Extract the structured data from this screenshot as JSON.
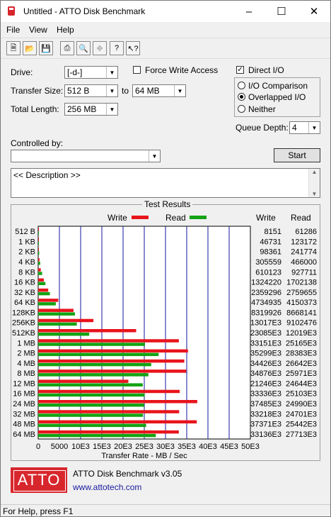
{
  "window": {
    "title": "Untitled - ATTO Disk Benchmark"
  },
  "menu": [
    "File",
    "View",
    "Help"
  ],
  "toolbar_icons": [
    "new-icon",
    "open-icon",
    "save-icon",
    "print-icon",
    "print-preview-icon",
    "move-icon",
    "help-icon",
    "context-help-icon"
  ],
  "labels": {
    "drive": "Drive:",
    "transfer_size": "Transfer Size:",
    "to": "to",
    "total_length": "Total Length:",
    "force_write": "Force Write Access",
    "direct_io": "Direct I/O",
    "io_comparison": "I/O Comparison",
    "overlapped_io": "Overlapped I/O",
    "neither": "Neither",
    "queue_depth": "Queue Depth:",
    "controlled_by": "Controlled by:",
    "start": "Start",
    "description": "<< Description >>",
    "test_results": "Test Results",
    "write": "Write",
    "read": "Read",
    "write_col": "Write",
    "read_col": "Read",
    "xlabel": "Transfer Rate - MB / Sec"
  },
  "values": {
    "drive": "[-d-]",
    "transfer_from": "512 B",
    "transfer_to": "64 MB",
    "total_length": "256 MB",
    "queue_depth": "4",
    "controlled_by": ""
  },
  "state": {
    "force_write": false,
    "direct_io": true,
    "mode": "overlapped_io"
  },
  "chart_data": {
    "type": "bar",
    "categories": [
      "512 B",
      "1 KB",
      "2 KB",
      "4 KB",
      "8 KB",
      "16 KB",
      "32 KB",
      "64 KB",
      "128KB",
      "256KB",
      "512KB",
      "1 MB",
      "2 MB",
      "4 MB",
      "8 MB",
      "12 MB",
      "16 MB",
      "24 MB",
      "32 MB",
      "48 MB",
      "64 MB"
    ],
    "series": [
      {
        "name": "Write",
        "color": "#e8141c",
        "values": [
          8151,
          46731,
          98361,
          305559,
          610123,
          1324220,
          2359296,
          4734935,
          8319926,
          13017000,
          23085000,
          33151000,
          35299000,
          34426000,
          34876000,
          21246000,
          33336000,
          37485000,
          33218000,
          37371000,
          33136000
        ]
      },
      {
        "name": "Read",
        "color": "#13a313",
        "values": [
          61286,
          123172,
          241774,
          466000,
          927711,
          1702138,
          2759655,
          4150373,
          8668141,
          9102476,
          12019000,
          25165000,
          28383000,
          26642000,
          25971000,
          24644000,
          25103000,
          24990000,
          24701000,
          25442000,
          27713000
        ]
      }
    ],
    "write_text": [
      "8151",
      "46731",
      "98361",
      "305559",
      "610123",
      "1324220",
      "2359296",
      "4734935",
      "8319926",
      "13017E3",
      "23085E3",
      "33151E3",
      "35299E3",
      "34426E3",
      "34876E3",
      "21246E3",
      "33336E3",
      "37485E3",
      "33218E3",
      "37371E3",
      "33136E3"
    ],
    "read_text": [
      "61286",
      "123172",
      "241774",
      "466000",
      "927711",
      "1702138",
      "2759655",
      "4150373",
      "8668141",
      "9102476",
      "12019E3",
      "25165E3",
      "28383E3",
      "26642E3",
      "25971E3",
      "24644E3",
      "25103E3",
      "24990E3",
      "24701E3",
      "25442E3",
      "27713E3"
    ],
    "xticks": [
      "0",
      "5000",
      "10E3",
      "15E3",
      "20E3",
      "25E3",
      "30E3",
      "35E3",
      "40E3",
      "45E3",
      "50E3"
    ],
    "xlim": [
      0,
      50000000
    ],
    "xlabel": "Transfer Rate - MB / Sec",
    "grid": true,
    "legend": "top"
  },
  "footer": {
    "app_name": "ATTO Disk Benchmark v3.05",
    "url": "www.attotech.com",
    "logo": "ATTO"
  },
  "status": "For Help, press F1"
}
